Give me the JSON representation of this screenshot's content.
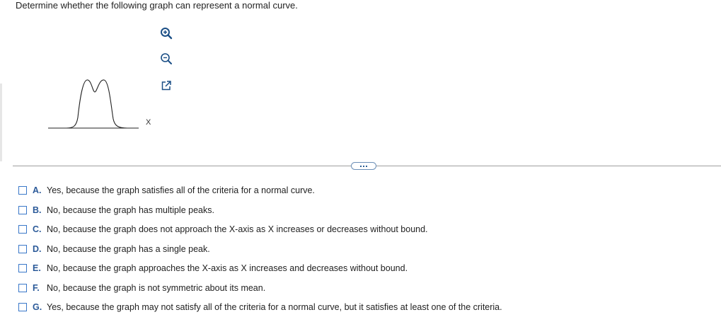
{
  "question": {
    "text": "Determine whether the following graph can represent a normal curve."
  },
  "graph": {
    "axis_label": "X",
    "tools": [
      {
        "name": "zoom-in-icon"
      },
      {
        "name": "zoom-out-icon"
      },
      {
        "name": "popout-icon"
      }
    ]
  },
  "more_button": {
    "icon": "ellipsis-icon"
  },
  "colors": {
    "accent": "#2b5a99",
    "checkbox_border": "#3a78c9",
    "divider": "#9e9e9e"
  },
  "options": [
    {
      "letter": "A.",
      "text": "Yes, because the graph satisfies all of the criteria for a normal curve."
    },
    {
      "letter": "B.",
      "text": "No, because the graph has multiple peaks."
    },
    {
      "letter": "C.",
      "text": "No, because the graph does not approach the X-axis as X increases or decreases without bound."
    },
    {
      "letter": "D.",
      "text": "No, because the graph has a single peak."
    },
    {
      "letter": "E.",
      "text": "No, because the graph approaches the X-axis as X increases and decreases without bound."
    },
    {
      "letter": "F.",
      "text": "No, because the graph is not symmetric about its mean."
    },
    {
      "letter": "G.",
      "text": "Yes, because the graph may not satisfy all of the criteria for a normal curve, but it satisfies at least one of the criteria."
    }
  ]
}
